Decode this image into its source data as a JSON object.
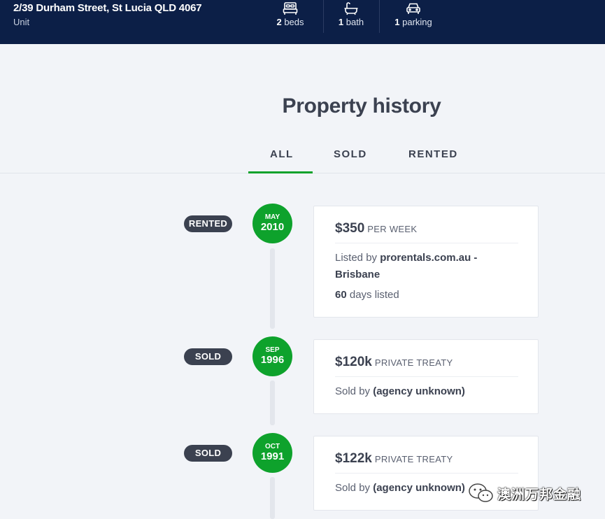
{
  "header": {
    "address": "2/39 Durham Street, St Lucia QLD 4067",
    "property_type": "Unit",
    "features": [
      {
        "icon": "bed-icon",
        "count": "2",
        "label": "beds"
      },
      {
        "icon": "bath-icon",
        "count": "1",
        "label": "bath"
      },
      {
        "icon": "car-icon",
        "count": "1",
        "label": "parking"
      }
    ]
  },
  "history": {
    "title": "Property history",
    "tabs": [
      {
        "label": "ALL",
        "active": true
      },
      {
        "label": "SOLD",
        "active": false
      },
      {
        "label": "RENTED",
        "active": false
      }
    ],
    "events": [
      {
        "badge": "RENTED",
        "month": "MAY",
        "year": "2010",
        "price": "$350",
        "price_type": "PER WEEK",
        "agent_prefix": "Listed by",
        "agent": "prorentals.com.au -",
        "agent_line2": "Brisbane",
        "days_count": "60",
        "days_label": "days listed"
      },
      {
        "badge": "SOLD",
        "month": "SEP",
        "year": "1996",
        "price": "$120k",
        "price_type": "PRIVATE TREATY",
        "agent_prefix": "Sold by",
        "agent": "(agency unknown)"
      },
      {
        "badge": "SOLD",
        "month": "OCT",
        "year": "1991",
        "price": "$122k",
        "price_type": "PRIVATE TREATY",
        "agent_prefix": "Sold by",
        "agent": "(agency unknown)"
      }
    ]
  },
  "watermark": {
    "text": "澳洲万邦金融"
  },
  "colors": {
    "navy": "#0c1f47",
    "green": "#0ea22c",
    "badge": "#3b4150"
  }
}
